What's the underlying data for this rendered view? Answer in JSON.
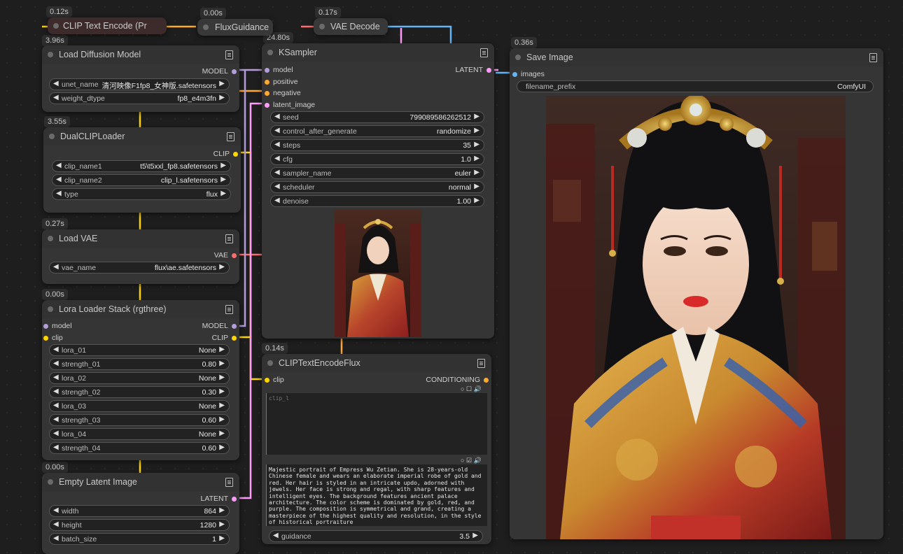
{
  "colors": {
    "model": "#b39ddb",
    "clip": "#ffd500",
    "vae": "#ff6e6e",
    "latent": "#ff9cf9",
    "conditioning": "#ffa931",
    "image": "#64b5f6"
  },
  "timings": {
    "clip_text_encode": "0.12s",
    "flux_guidance": "0.00s",
    "vae_decode": "0.17s",
    "load_diffusion": "3.96s",
    "ksampler": "24.80s",
    "save_image": "0.36s",
    "dual_clip": "3.55s",
    "load_vae": "0.27s",
    "lora": "0.00s",
    "clip_flux": "0.14s",
    "empty_latent": "0.00s"
  },
  "nodes": {
    "clip_text_encode": {
      "title": "CLIP Text Encode (Pr"
    },
    "flux_guidance": {
      "title": "FluxGuidance"
    },
    "vae_decode": {
      "title": "VAE Decode"
    },
    "load_diffusion": {
      "title": "Load Diffusion Model",
      "output": "MODEL",
      "widgets": [
        {
          "label": "unet_name",
          "value": "清河映像F1fp8_女神版.safetensors"
        },
        {
          "label": "weight_dtype",
          "value": "fp8_e4m3fn"
        }
      ]
    },
    "dual_clip": {
      "title": "DualCLIPLoader",
      "output": "CLIP",
      "widgets": [
        {
          "label": "clip_name1",
          "value": "t5\\t5xxl_fp8.safetensors"
        },
        {
          "label": "clip_name2",
          "value": "clip_l.safetensors"
        },
        {
          "label": "type",
          "value": "flux"
        }
      ]
    },
    "load_vae": {
      "title": "Load VAE",
      "output": "VAE",
      "widgets": [
        {
          "label": "vae_name",
          "value": "flux\\ae.safetensors"
        }
      ]
    },
    "lora": {
      "title": "Lora Loader Stack (rgthree)",
      "inputs": [
        "model",
        "clip"
      ],
      "outputs": [
        "MODEL",
        "CLIP"
      ],
      "widgets": [
        {
          "label": "lora_01",
          "value": "None"
        },
        {
          "label": "strength_01",
          "value": "0.80"
        },
        {
          "label": "lora_02",
          "value": "None"
        },
        {
          "label": "strength_02",
          "value": "0.30"
        },
        {
          "label": "lora_03",
          "value": "None"
        },
        {
          "label": "strength_03",
          "value": "0.60"
        },
        {
          "label": "lora_04",
          "value": "None"
        },
        {
          "label": "strength_04",
          "value": "0.60"
        }
      ]
    },
    "empty_latent": {
      "title": "Empty Latent Image",
      "output": "LATENT",
      "widgets": [
        {
          "label": "width",
          "value": "864"
        },
        {
          "label": "height",
          "value": "1280"
        },
        {
          "label": "batch_size",
          "value": "1"
        }
      ]
    },
    "ksampler": {
      "title": "KSampler",
      "inputs": [
        "model",
        "positive",
        "negative",
        "latent_image"
      ],
      "output": "LATENT",
      "widgets": [
        {
          "label": "seed",
          "value": "799089586262512"
        },
        {
          "label": "control_after_generate",
          "value": "randomize"
        },
        {
          "label": "steps",
          "value": "35"
        },
        {
          "label": "cfg",
          "value": "1.0"
        },
        {
          "label": "sampler_name",
          "value": "euler"
        },
        {
          "label": "scheduler",
          "value": "normal"
        },
        {
          "label": "denoise",
          "value": "1.00"
        }
      ]
    },
    "clip_flux": {
      "title": "CLIPTextEncodeFlux",
      "input": "clip",
      "output": "CONDITIONING",
      "clip_l_placeholder": "clip_l",
      "t5xxl_text": "Majestic portrait of Empress Wu Zetian. She is 28-years-old Chinese female and wears an elaborate imperial robe of gold and red. Her hair is styled in an intricate updo, adorned with jewels. Her face is strong and regal, with sharp features and intelligent eyes. The background features ancient palace architecture. The color scheme is dominated by gold, red, and purple. The composition is symmetrical and grand, creating a masterpiece of the highest quality and resolution, in the style of historical portraiture",
      "widgets": [
        {
          "label": "guidance",
          "value": "3.5"
        }
      ]
    },
    "save_image": {
      "title": "Save Image",
      "input": "images",
      "widgets": [
        {
          "label": "filename_prefix",
          "value": "ComfyUI"
        }
      ]
    }
  }
}
